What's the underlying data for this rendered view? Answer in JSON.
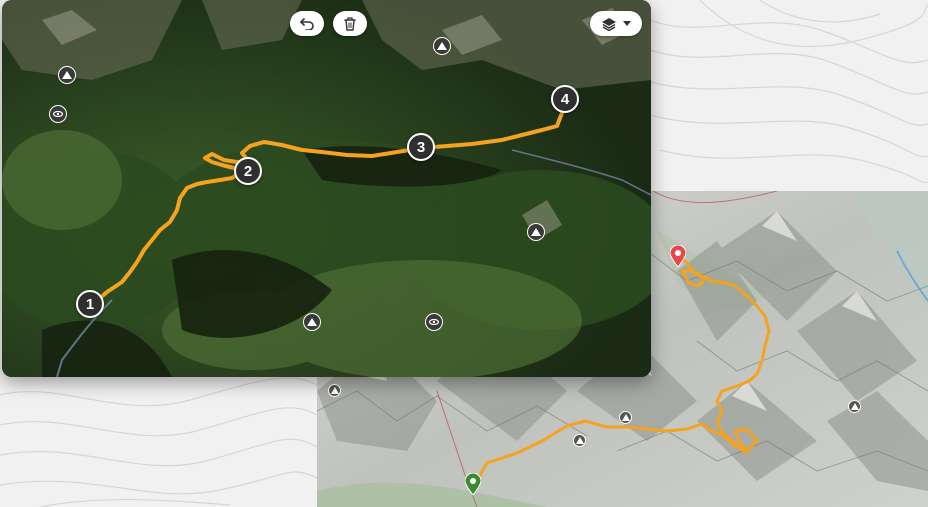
{
  "toolbar": {
    "undo_icon": "undo-icon",
    "delete_icon": "trash-icon",
    "layers_icon": "layers-icon",
    "layers_caret": "chevron-down-icon"
  },
  "route": {
    "color": "#f5a21f",
    "waypoints": [
      {
        "label": "1"
      },
      {
        "label": "2"
      },
      {
        "label": "3"
      },
      {
        "label": "4"
      }
    ]
  },
  "satellite_map": {
    "poi_icons": [
      "peak-icon",
      "peak-icon",
      "viewpoint-icon",
      "peak-icon",
      "peak-icon",
      "viewpoint-icon"
    ]
  },
  "relief_map": {
    "start_marker_color": "#3a8a2e",
    "end_marker_color": "#e5484d",
    "poi_icons": [
      "peak-icon",
      "peak-icon",
      "peak-icon",
      "peak-icon"
    ]
  }
}
